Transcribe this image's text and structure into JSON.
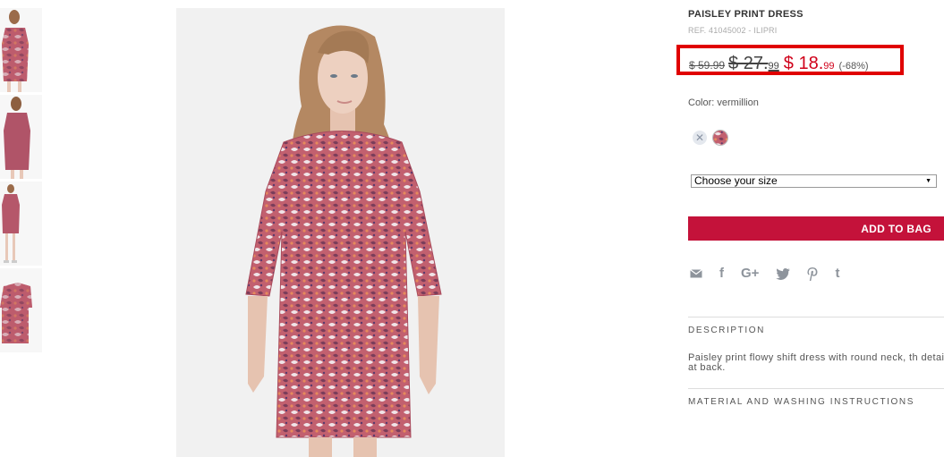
{
  "product": {
    "title": "PAISLEY PRINT DRESS",
    "ref": "REF. 41045002 - ILIPRI"
  },
  "price": {
    "original": "$ 59.99",
    "previous_main": "$ 27.",
    "previous_cents": "99",
    "sale_main": "$ 18.",
    "sale_cents": "99",
    "discount": "(-68%)",
    "sale_color": "#d0021b",
    "highlight_color": "#e00000"
  },
  "color": {
    "label": "Color: vermillion",
    "swatches": [
      "close-icon",
      "paisley-pattern"
    ]
  },
  "size": {
    "selected": "Choose your size",
    "arrow": "▼"
  },
  "actions": {
    "add_to_bag": "ADD TO BAG",
    "button_color": "#c4123a"
  },
  "share": {
    "icons": [
      "mail-icon",
      "facebook-icon",
      "google-plus-icon",
      "twitter-icon",
      "pinterest-icon",
      "tumblr-icon"
    ],
    "glyphs": [
      "✉",
      "f",
      "G+",
      "🐦",
      "℗",
      "t"
    ]
  },
  "sections": {
    "description_heading": "DESCRIPTION",
    "description_text": "Paisley print flowy shift dress with round neck, th detail at back.",
    "material_heading": "MATERIAL AND WASHING INSTRUCTIONS"
  }
}
